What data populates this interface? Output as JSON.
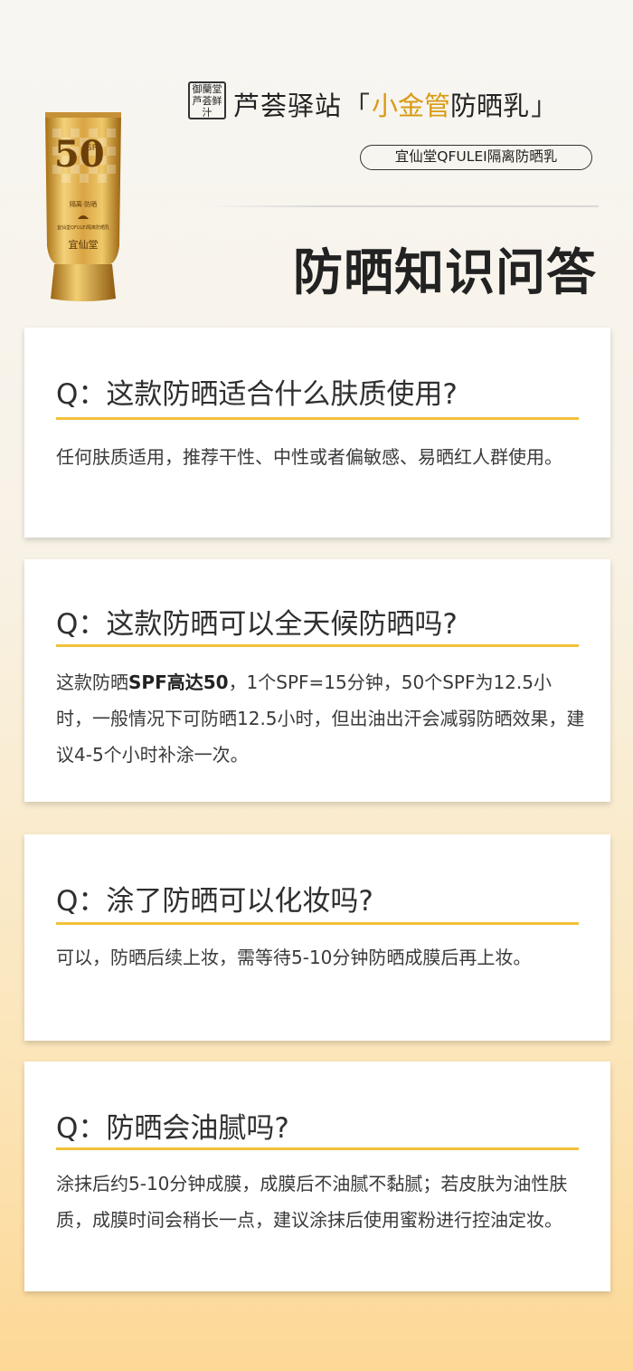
{
  "header": {
    "seal_text": "御蘭堂芦荟鲜汁",
    "brand_name": "芦荟驿站",
    "bracket_open": "「",
    "highlight": "小金管",
    "product": "防晒乳",
    "bracket_close": "」",
    "subtitle": "宜仙堂QFULEI隔离防晒乳",
    "page_title": "防晒知识问答"
  },
  "tube": {
    "spf_number": "50",
    "spf_label": "SPF",
    "tag": "隔离·防晒",
    "fine_print": "宜仙堂QFULEI隔离防晒乳",
    "logo": "宜仙堂"
  },
  "colors": {
    "accent": "#f2c13a",
    "highlight_text": "#d99a12",
    "gold_tube": "#c8952a"
  },
  "faq": [
    {
      "question": "Q：这款防晒适合什么肤质使用?",
      "answer": "任何肤质适用，推荐干性、中性或者偏敏感、易晒红人群使用。"
    },
    {
      "question": "Q：这款防晒可以全天候防晒吗?",
      "answer_pre": "这款防晒",
      "answer_bold": "SPF高达50",
      "answer_post": "，1个SPF=15分钟，50个SPF为12.5小时，一般情况下可防晒12.5小时，但出油出汗会减弱防晒效果，建议4-5个小时补涂一次。"
    },
    {
      "question": "Q：涂了防晒可以化妆吗?",
      "answer": "可以，防晒后续上妆，需等待5-10分钟防晒成膜后再上妆。"
    },
    {
      "question": "Q：防晒会油腻吗?",
      "answer": "涂抹后约5-10分钟成膜，成膜后不油腻不黏腻；若皮肤为油性肤质，成膜时间会稍长一点，建议涂抹后使用蜜粉进行控油定妆。"
    }
  ]
}
